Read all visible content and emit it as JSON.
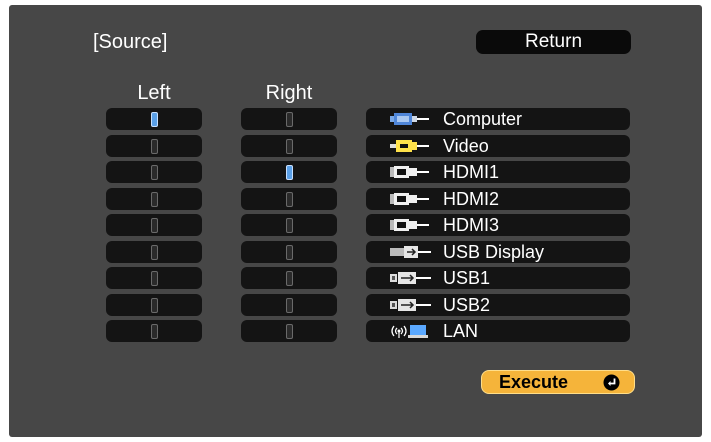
{
  "header": {
    "title": "[Source]",
    "return_label": "Return"
  },
  "columns": {
    "left": "Left",
    "right": "Right"
  },
  "left_selected": [
    true,
    false,
    false,
    false,
    false,
    false,
    false,
    false,
    false
  ],
  "right_selected": [
    false,
    false,
    true,
    false,
    false,
    false,
    false,
    false,
    false
  ],
  "sources": [
    {
      "label": "Computer",
      "icon": "computer-vga-icon"
    },
    {
      "label": "Video",
      "icon": "video-rca-icon"
    },
    {
      "label": "HDMI1",
      "icon": "hdmi-icon"
    },
    {
      "label": "HDMI2",
      "icon": "hdmi-icon"
    },
    {
      "label": "HDMI3",
      "icon": "hdmi-icon"
    },
    {
      "label": "USB Display",
      "icon": "usb-display-icon"
    },
    {
      "label": "USB1",
      "icon": "usb-a-icon"
    },
    {
      "label": "USB2",
      "icon": "usb-a-icon"
    },
    {
      "label": "LAN",
      "icon": "lan-wireless-icon"
    }
  ],
  "footer": {
    "execute_label": "Execute"
  },
  "colors": {
    "background": "#474747",
    "row": "#141414",
    "toggle_on": "#5aa0e8",
    "execute": "#f5b43a",
    "text": "#ffffff"
  }
}
